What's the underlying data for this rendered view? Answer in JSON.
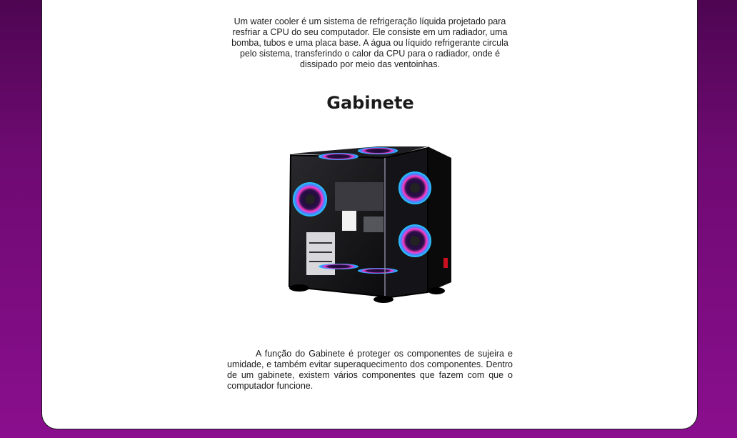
{
  "water_cooler": {
    "text": "Um water cooler é um sistema de refrigeração líquida projetado para resfriar a CPU do seu computador. Ele consiste em um radiador, uma bomba, tubos e uma placa base. A água ou líquido refrigerante circula pelo sistema, transferindo o calor da CPU para o radiador, onde é dissipado por meio das ventoinhas."
  },
  "gabinete": {
    "title": "Gabinete",
    "image_icon": "pc-case-image",
    "text": "A função do Gabinete é proteger os componentes de sujeira e umidade, e também evitar superaquecimento dos componentes. Dentro de um gabinete, existem vários componentes que fazem com que o computador funcione."
  },
  "colors": {
    "background_top": "#4e0552",
    "background_bottom": "#8a0e8e",
    "card": "#ffffff",
    "text": "#1c1c1c",
    "rgb_fan": "#c03cff"
  }
}
